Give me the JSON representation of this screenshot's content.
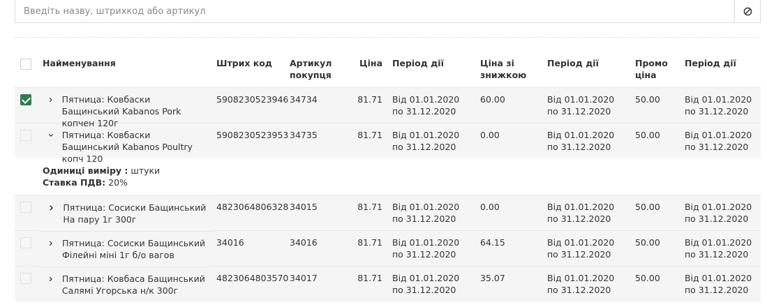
{
  "search": {
    "placeholder": "Введіть назву, штрихкод або артикул",
    "clear_icon": "clear-icon"
  },
  "table": {
    "headers": {
      "name": "Найменування",
      "barcode": "Штрих код",
      "article": "Артикул покупця",
      "price": "Ціна",
      "period1": "Період дії",
      "discount_price": "Ціна зі знижкою",
      "period2": "Період дії",
      "promo_price": "Промо ціна",
      "period3": "Період дії"
    },
    "rows": [
      {
        "checked": true,
        "expanded": false,
        "name": "Пятница: Ковбаски Бащинський Kabanos Pork копчен 120г",
        "barcode": "5908230523946",
        "article": "34734",
        "price": "81.71",
        "period1": "Від 01.01.2020 по 31.12.2020",
        "discount_price": "60.00",
        "period2": "Від 01.01.2020 по 31.12.2020",
        "promo_price": "50.00",
        "period3": "Від 01.01.2020 по 31.12.2020"
      },
      {
        "checked": false,
        "expanded": true,
        "name": "Пятница: Ковбаски Бащинський Kabanos Poultry копч 120",
        "barcode": "5908230523953",
        "article": "34735",
        "price": "81.71",
        "period1": "Від 01.01.2020 по 31.12.2020",
        "discount_price": "0.00",
        "period2": "Від 01.01.2020 по 31.12.2020",
        "promo_price": "50.00",
        "period3": "Від 01.01.2020 по 31.12.2020"
      },
      {
        "checked": false,
        "expanded": false,
        "name": "Пятница: Сосиски Бащинський На пару 1г 300г",
        "barcode": "4823064806328",
        "article": "34015",
        "price": "81.71",
        "period1": "Від 01.01.2020 по 31.12.2020",
        "discount_price": "0.00",
        "period2": "Від 01.01.2020 по 31.12.2020",
        "promo_price": "50.00",
        "period3": "Від 01.01.2020 по 31.12.2020"
      },
      {
        "checked": false,
        "expanded": false,
        "name": "Пятница: Сосиски Бащинський Філейні міні 1г б/о вагов",
        "barcode": "34016",
        "article": "34016",
        "price": "81.71",
        "period1": "Від 01.01.2020 по 31.12.2020",
        "discount_price": "64.15",
        "period2": "Від 01.01.2020 по 31.12.2020",
        "promo_price": "50.00",
        "period3": "Від 01.01.2020 по 31.12.2020"
      },
      {
        "checked": false,
        "expanded": false,
        "name": "Пятница: Ковбаса Бащинський Салямі Угорська н/к 300г",
        "barcode": "4823064803570",
        "article": "34017",
        "price": "81.71",
        "period1": "Від 01.01.2020 по 31.12.2020",
        "discount_price": "35.07",
        "period2": "Від 01.01.2020 по 31.12.2020",
        "promo_price": "50.00",
        "period3": "Від 01.01.2020 по 31.12.2020"
      }
    ],
    "detail": {
      "units_label": "Одиниці виміру :",
      "units_value": "штуки",
      "vat_label": "Ставка ПДВ:",
      "vat_value": "20%"
    }
  },
  "colors": {
    "accent": "#2e7d4f",
    "row_bg": "#f5f5f5"
  }
}
